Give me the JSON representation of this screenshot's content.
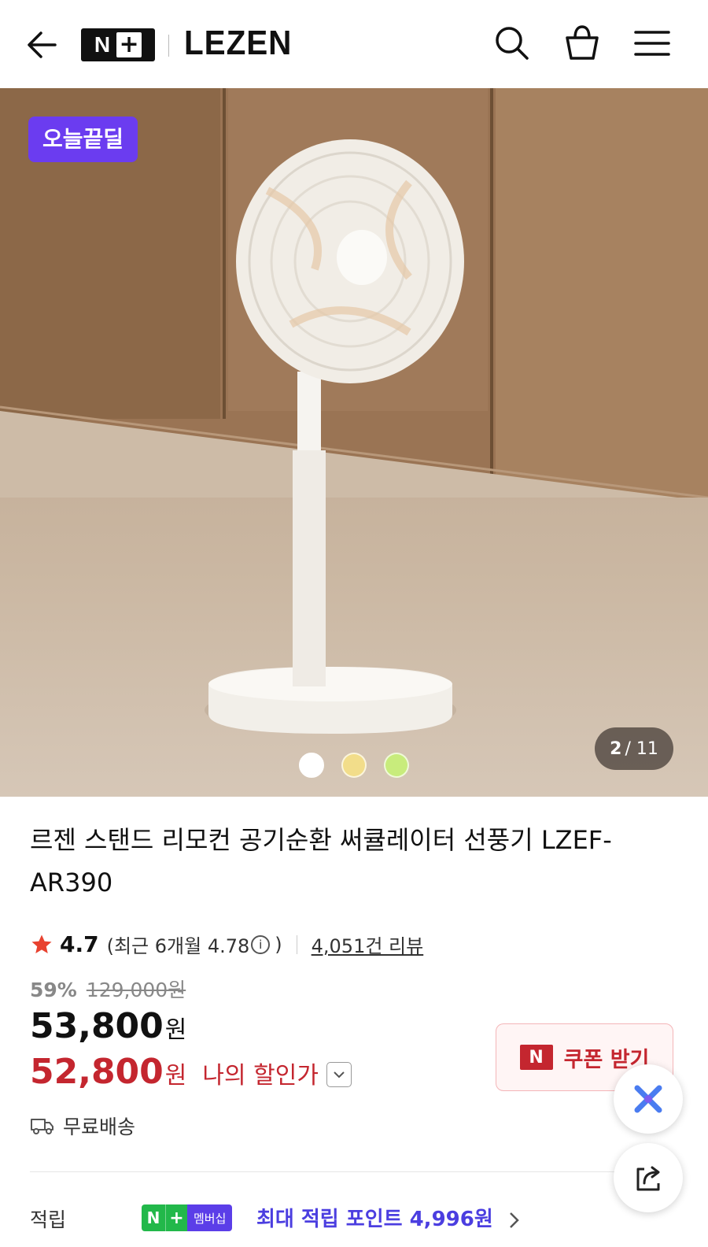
{
  "header": {
    "logo_n": "N",
    "logo_plus": "+",
    "brand": "LEZEN",
    "icons": [
      "back-arrow-icon",
      "search-icon",
      "shopping-bag-icon",
      "menu-icon"
    ]
  },
  "hero": {
    "badge": "오늘끝딜",
    "counter_current": "2",
    "counter_total": "/ 11",
    "color_dots": [
      "#ffffff",
      "#f2dd8a",
      "#c8ec7c"
    ],
    "selected_dot": 0
  },
  "product": {
    "title": "르젠 스탠드 리모컨 공기순환 써큘레이터 선풍기 LZEF-AR390",
    "rating": "4.7",
    "recent_rating": "(최근 6개월 4.78",
    "recent_close": ")",
    "review_count": "4,051건 리뷰",
    "discount_rate": "59%",
    "original_price": "129,000원",
    "price": "53,800",
    "my_price": "52,800",
    "won": "원",
    "my_price_label": "나의 할인가",
    "coupon_badge": "N",
    "coupon_label": "쿠폰 받기",
    "shipping": "무료배송"
  },
  "points": {
    "label": "적립",
    "badge_n": "N",
    "badge_plus": "+",
    "badge_membership": "멤버십",
    "text": "최대 적립 포인트 4,996원"
  },
  "colors": {
    "accent_red": "#c4262f",
    "deal_purple": "#6b3cf0",
    "points_purple": "#4b3ee0",
    "naver_green": "#22b84a"
  }
}
